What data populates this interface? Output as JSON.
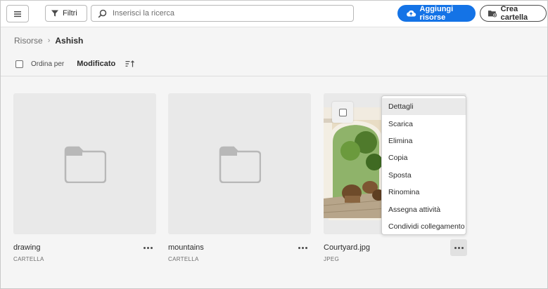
{
  "toolbar": {
    "filter_label": "Filtri",
    "search_placeholder": "Inserisci la ricerca",
    "add_label": "Aggiungi risorse",
    "create_label": "Crea cartella"
  },
  "breadcrumb": {
    "root": "Risorse",
    "separator": "›",
    "current": "Ashish"
  },
  "sort": {
    "label": "Ordina per",
    "value": "Modificato"
  },
  "cards": [
    {
      "name": "drawing",
      "type": "CARTELLA",
      "icon": "folder-icon"
    },
    {
      "name": "mountains",
      "type": "CARTELLA",
      "icon": "folder-icon"
    },
    {
      "name": "Courtyard.jpg",
      "type": "JPEG",
      "icon": "image-thumbnail"
    }
  ],
  "context_menu": {
    "items": [
      "Dettagli",
      "Scarica",
      "Elimina",
      "Copia",
      "Sposta",
      "Rinomina",
      "Assegna attività",
      "Condividi collegamento"
    ]
  },
  "colors": {
    "accent": "#1473e6",
    "background": "#f5f5f5",
    "thumb": "#e9e9e9"
  }
}
